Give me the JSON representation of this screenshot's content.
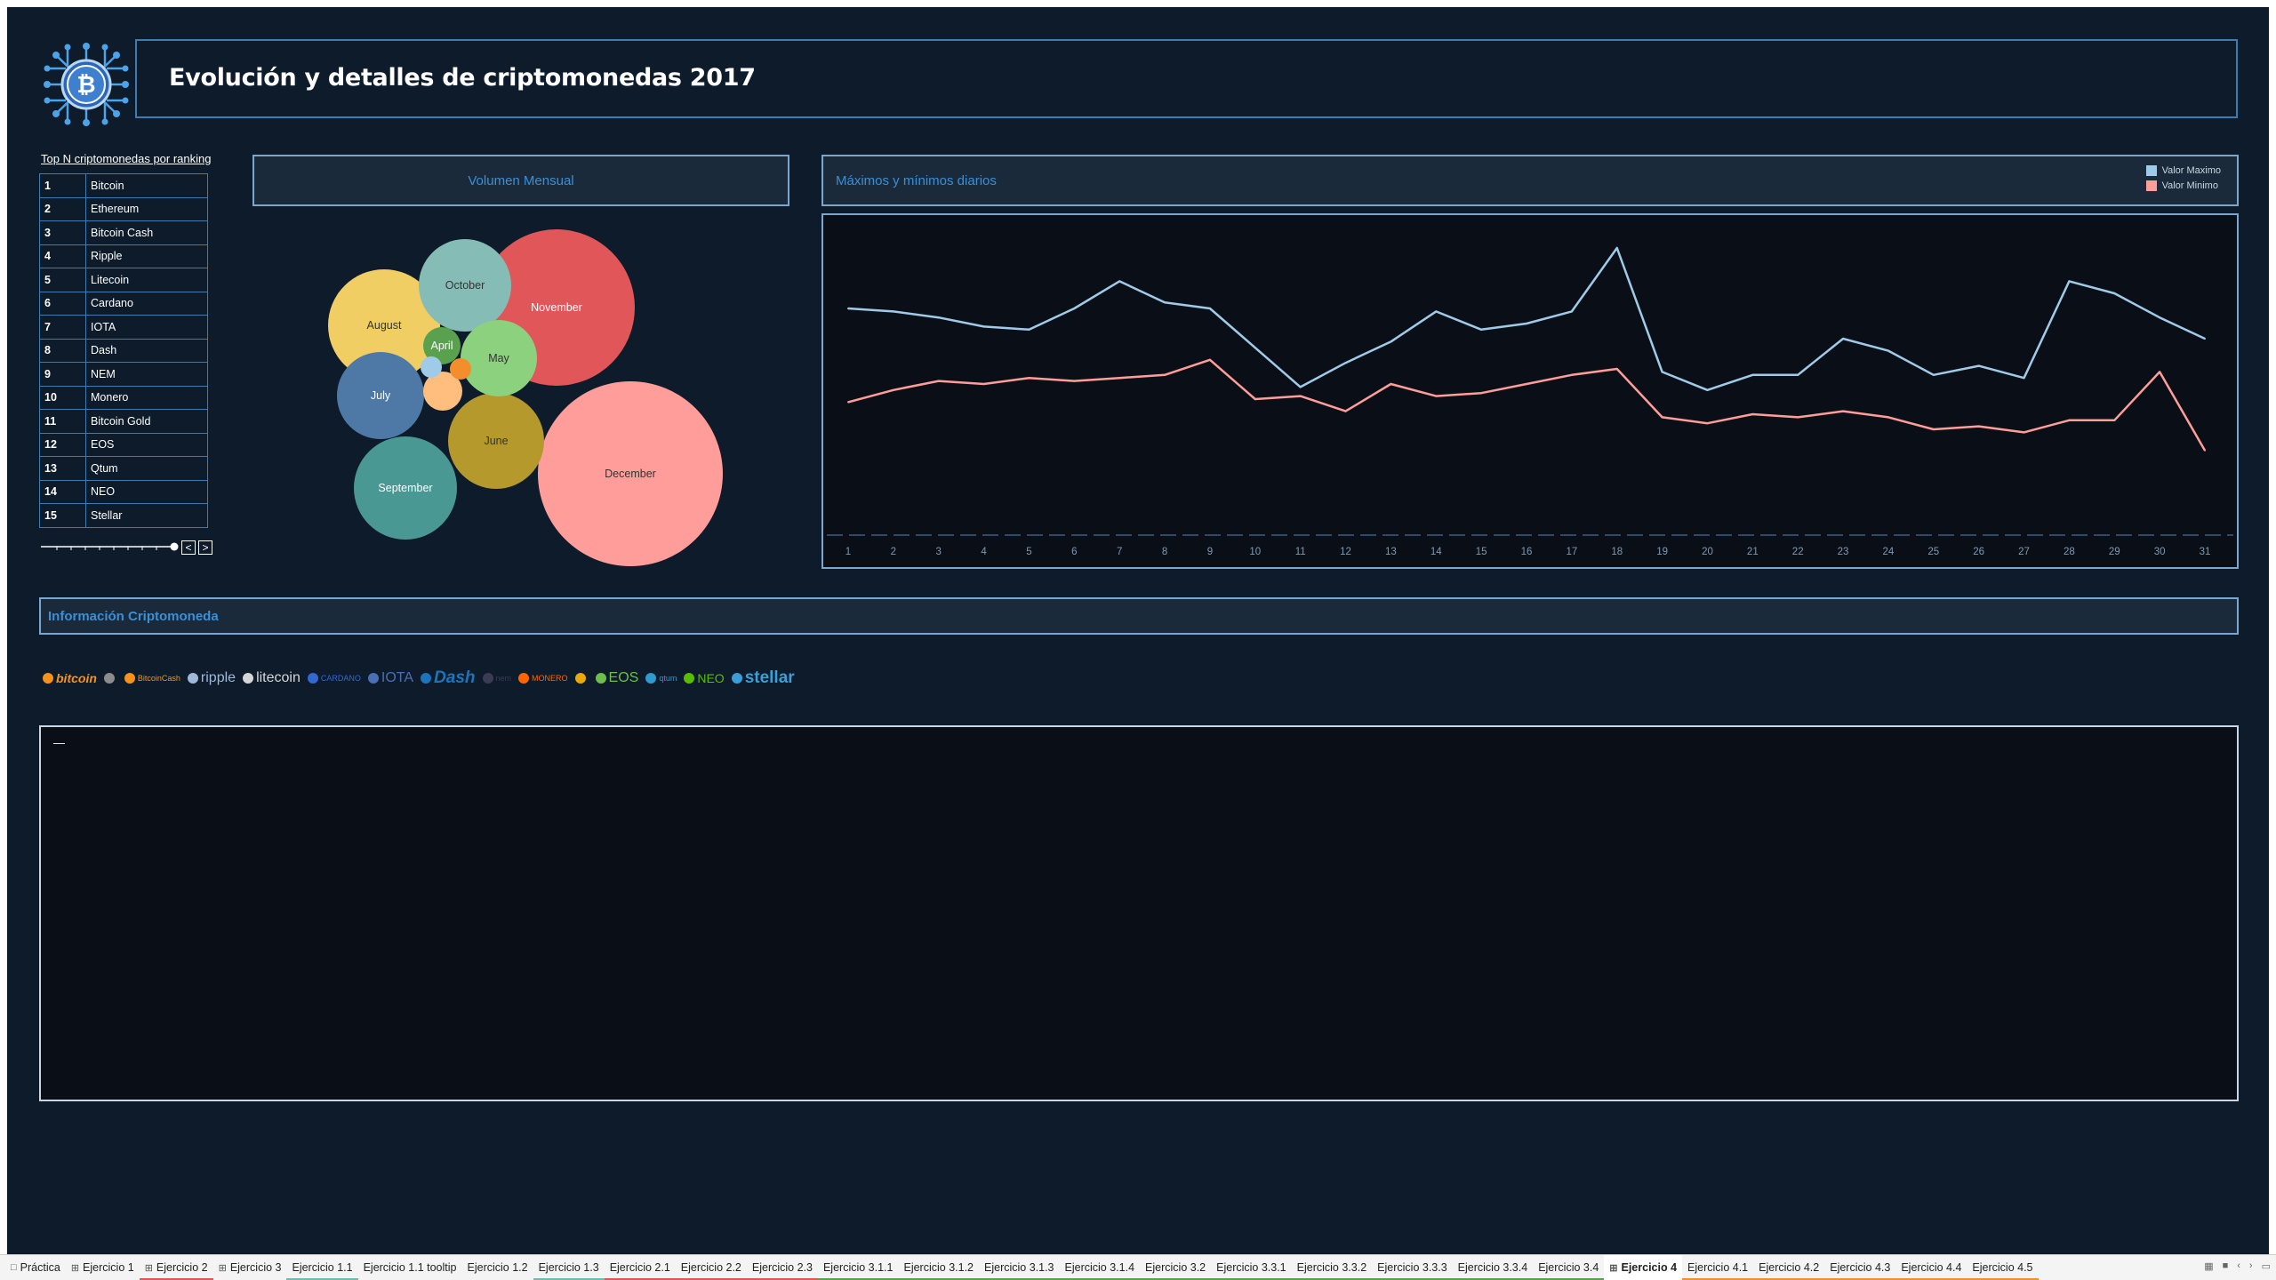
{
  "title": "Evolución y detalles de criptomonedas 2017",
  "ranking": {
    "title": "Top N criptomonedas por ranking",
    "rows": [
      {
        "rank": "1",
        "name": "Bitcoin"
      },
      {
        "rank": "2",
        "name": "Ethereum"
      },
      {
        "rank": "3",
        "name": "Bitcoin Cash"
      },
      {
        "rank": "4",
        "name": "Ripple"
      },
      {
        "rank": "5",
        "name": "Litecoin"
      },
      {
        "rank": "6",
        "name": "Cardano"
      },
      {
        "rank": "7",
        "name": "IOTA"
      },
      {
        "rank": "8",
        "name": "Dash"
      },
      {
        "rank": "9",
        "name": "NEM"
      },
      {
        "rank": "10",
        "name": "Monero"
      },
      {
        "rank": "11",
        "name": "Bitcoin Gold"
      },
      {
        "rank": "12",
        "name": "EOS"
      },
      {
        "rank": "13",
        "name": "Qtum"
      },
      {
        "rank": "14",
        "name": "NEO"
      },
      {
        "rank": "15",
        "name": "Stellar"
      }
    ],
    "prev_label": "<",
    "next_label": ">"
  },
  "volumen": {
    "title": "Volumen Mensual",
    "bubbles": [
      {
        "label": "December",
        "color": "#ff9d9a"
      },
      {
        "label": "November",
        "color": "#e15759"
      },
      {
        "label": "August",
        "color": "#f1ce63"
      },
      {
        "label": "October",
        "color": "#86bcb6"
      },
      {
        "label": "September",
        "color": "#499894"
      },
      {
        "label": "July",
        "color": "#4e79a7"
      },
      {
        "label": "June",
        "color": "#b6992d"
      },
      {
        "label": "May",
        "color": "#8cd17d"
      },
      {
        "label": "April",
        "color": "#59a14f"
      },
      {
        "label": "",
        "color": "#ffbe7d"
      },
      {
        "label": "",
        "color": "#f28e2b"
      },
      {
        "label": "",
        "color": "#a0cbe8"
      }
    ]
  },
  "maximos": {
    "title": "Máximos y mínimos diarios",
    "legend": [
      {
        "label": "Valor Maximo",
        "color": "#a0cbe8"
      },
      {
        "label": "Valor Minimo",
        "color": "#ff9d9a"
      }
    ]
  },
  "chart_data": {
    "type": "line",
    "title": "Máximos y mínimos diarios",
    "x": [
      1,
      2,
      3,
      4,
      5,
      6,
      7,
      8,
      9,
      10,
      11,
      12,
      13,
      14,
      15,
      16,
      17,
      18,
      19,
      20,
      21,
      22,
      23,
      24,
      25,
      26,
      27,
      28,
      29,
      30,
      31
    ],
    "series": [
      {
        "name": "Valor Maximo",
        "color": "#a0cbe8",
        "values": [
          75,
          74,
          72,
          69,
          68,
          75,
          84,
          77,
          75,
          62,
          49,
          57,
          64,
          74,
          68,
          70,
          74,
          95,
          54,
          48,
          53,
          53,
          65,
          61,
          53,
          56,
          52,
          84,
          80,
          72,
          65
        ]
      },
      {
        "name": "Valor Minimo",
        "color": "#ff9d9a",
        "values": [
          44,
          48,
          51,
          50,
          52,
          51,
          52,
          53,
          58,
          45,
          46,
          41,
          50,
          46,
          47,
          50,
          53,
          55,
          39,
          37,
          40,
          39,
          41,
          39,
          35,
          36,
          34,
          38,
          38,
          54,
          28
        ]
      }
    ],
    "ylim": [
      0,
      100
    ],
    "xlabel": "",
    "ylabel": "",
    "legend": "top-right",
    "grid": false
  },
  "info": {
    "title": "Información Criptomoneda",
    "placeholder": "—",
    "logos": [
      {
        "name": "bitcoin",
        "label": "bitcoin",
        "color": "#f7931a"
      },
      {
        "name": "ethereum",
        "label": "",
        "color": "#8c8c8c"
      },
      {
        "name": "bitcoincash",
        "label": "BitcoinCash",
        "color": "#f7931a"
      },
      {
        "name": "ripple",
        "label": "ripple",
        "color": "#9db8d9"
      },
      {
        "name": "litecoin",
        "label": "litecoin",
        "color": "#d6d6d6"
      },
      {
        "name": "cardano",
        "label": "CARDANO",
        "color": "#3468d1"
      },
      {
        "name": "iota",
        "label": "IOTA",
        "color": "#4a6fb5"
      },
      {
        "name": "dash",
        "label": "Dash",
        "color": "#1c75bc"
      },
      {
        "name": "nem",
        "label": "nem",
        "color": "#3b3b55"
      },
      {
        "name": "monero",
        "label": "MONERO",
        "color": "#ff6600"
      },
      {
        "name": "bitcoingold",
        "label": "",
        "color": "#eba809"
      },
      {
        "name": "eos",
        "label": "EOS",
        "color": "#6cbf4b"
      },
      {
        "name": "qtum",
        "label": "qtum",
        "color": "#2e9ad0"
      },
      {
        "name": "neo",
        "label": "NEO",
        "color": "#58bf00"
      },
      {
        "name": "stellar",
        "label": "stellar",
        "color": "#3a9fd9"
      }
    ]
  },
  "tabs": [
    {
      "label": "Práctica",
      "icon": "□",
      "color": ""
    },
    {
      "label": "Ejercicio 1",
      "icon": "⊞",
      "color": ""
    },
    {
      "label": "Ejercicio 2",
      "icon": "⊞",
      "color": "#e15759"
    },
    {
      "label": "Ejercicio 3",
      "icon": "⊞",
      "color": ""
    },
    {
      "label": "Ejercicio 1.1",
      "icon": "",
      "color": "#76b7b2"
    },
    {
      "label": "Ejercicio 1.1 tooltip",
      "icon": "",
      "color": ""
    },
    {
      "label": "Ejercicio 1.2",
      "icon": "",
      "color": ""
    },
    {
      "label": "Ejercicio 1.3",
      "icon": "",
      "color": "#76b7b2"
    },
    {
      "label": "Ejercicio 2.1",
      "icon": "",
      "color": "#e15759"
    },
    {
      "label": "Ejercicio 2.2",
      "icon": "",
      "color": "#e15759"
    },
    {
      "label": "Ejercicio 2.3",
      "icon": "",
      "color": "#e15759"
    },
    {
      "label": "Ejercicio 3.1.1",
      "icon": "",
      "color": "#59a14f"
    },
    {
      "label": "Ejercicio 3.1.2",
      "icon": "",
      "color": "#59a14f"
    },
    {
      "label": "Ejercicio 3.1.3",
      "icon": "",
      "color": "#59a14f"
    },
    {
      "label": "Ejercicio 3.1.4",
      "icon": "",
      "color": "#59a14f"
    },
    {
      "label": "Ejercicio 3.2",
      "icon": "",
      "color": "#59a14f"
    },
    {
      "label": "Ejercicio 3.3.1",
      "icon": "",
      "color": "#59a14f"
    },
    {
      "label": "Ejercicio 3.3.2",
      "icon": "",
      "color": "#59a14f"
    },
    {
      "label": "Ejercicio 3.3.3",
      "icon": "",
      "color": "#59a14f"
    },
    {
      "label": "Ejercicio 3.3.4",
      "icon": "",
      "color": "#59a14f"
    },
    {
      "label": "Ejercicio 3.4",
      "icon": "",
      "color": "#59a14f"
    },
    {
      "label": "Ejercicio 4",
      "icon": "⊞",
      "color": "",
      "active": true
    },
    {
      "label": "Ejercicio 4.1",
      "icon": "",
      "color": "#f28e2b"
    },
    {
      "label": "Ejercicio 4.2",
      "icon": "",
      "color": "#f28e2b"
    },
    {
      "label": "Ejercicio 4.3",
      "icon": "",
      "color": "#f28e2b"
    },
    {
      "label": "Ejercicio 4.4",
      "icon": "",
      "color": "#f28e2b"
    },
    {
      "label": "Ejercicio 4.5",
      "icon": "",
      "color": "#f28e2b"
    }
  ]
}
